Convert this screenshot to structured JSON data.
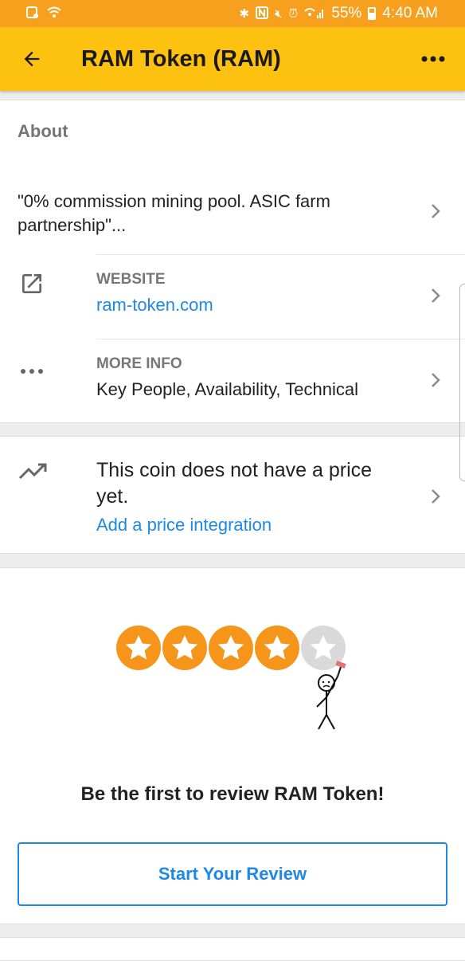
{
  "status_bar": {
    "battery": "55%",
    "time": "4:40 AM"
  },
  "app_bar": {
    "title": "RAM Token (RAM)"
  },
  "about": {
    "heading": "About",
    "description": "\"0% commission mining pool. ASIC farm partnership\"...",
    "website_label": "WEBSITE",
    "website_value": "ram-token.com",
    "more_info_label": "MORE INFO",
    "more_info_value": "Key People, Availability, Technical"
  },
  "price": {
    "message": "This coin does not have a price yet.",
    "link": "Add a price integration"
  },
  "review": {
    "rating_shown": 4,
    "rating_max": 5,
    "title": "Be the first to review RAM Token!",
    "button": "Start Your Review"
  },
  "colors": {
    "status_bar": "#f6a01e",
    "app_bar": "#fdc10f",
    "star_on": "#f5961b",
    "star_off": "#d9d9d9",
    "link": "#1e88e5"
  },
  "icons": [
    "back-arrow-icon",
    "more-vert-icon",
    "external-link-icon",
    "more-horiz-icon",
    "trending-up-icon",
    "chevron-right-icon",
    "star-icon"
  ]
}
